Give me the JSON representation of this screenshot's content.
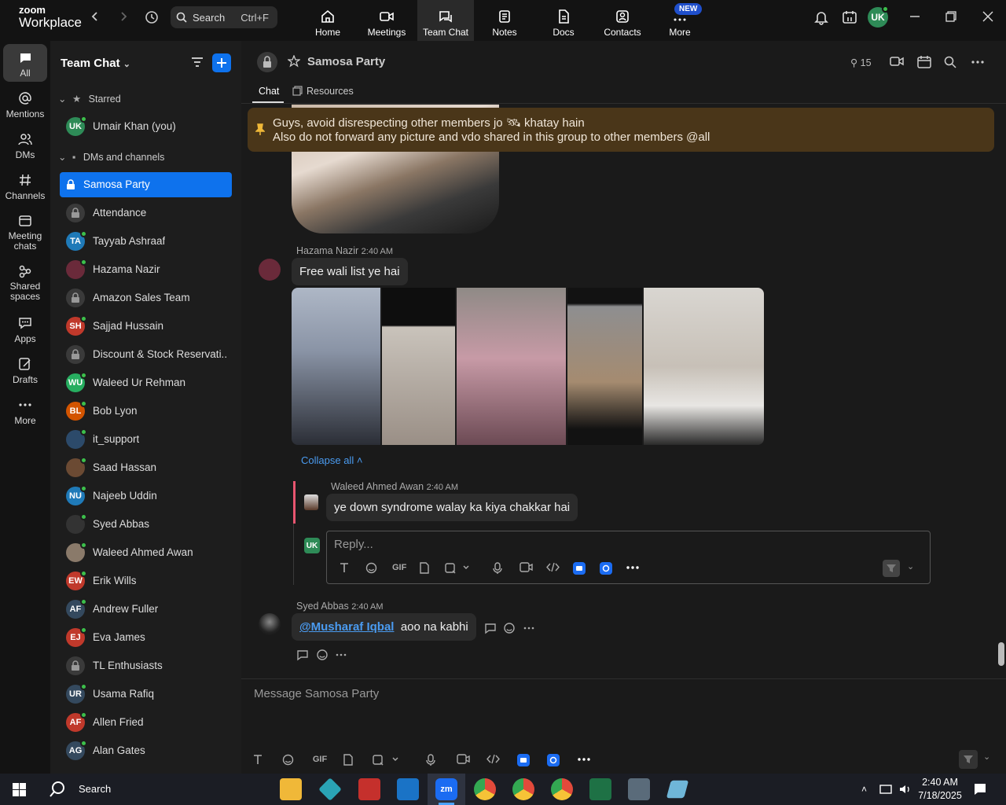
{
  "app": {
    "brand_top": "zoom",
    "brand_bottom": "Workplace"
  },
  "topbar": {
    "search_placeholder": "Search",
    "search_shortcut": "Ctrl+F",
    "nav": [
      {
        "label": "Home",
        "icon": "home-icon"
      },
      {
        "label": "Meetings",
        "icon": "video-icon"
      },
      {
        "label": "Team Chat",
        "icon": "chat-icon",
        "active": true
      },
      {
        "label": "Notes",
        "icon": "notes-icon"
      },
      {
        "label": "Docs",
        "icon": "docs-icon"
      },
      {
        "label": "Contacts",
        "icon": "contacts-icon"
      },
      {
        "label": "More",
        "icon": "more-icon"
      }
    ],
    "new_badge": "NEW",
    "user_initials": "UK"
  },
  "rail": [
    {
      "label": "All"
    },
    {
      "label": "Mentions"
    },
    {
      "label": "DMs"
    },
    {
      "label": "Channels"
    },
    {
      "label": "Meeting chats"
    },
    {
      "label": "Shared spaces"
    },
    {
      "label": "Apps"
    },
    {
      "label": "Drafts"
    },
    {
      "label": "More"
    }
  ],
  "sidebar": {
    "title": "Team Chat",
    "starred_label": "Starred",
    "dms_label": "DMs and channels",
    "starred": [
      {
        "name": "Umair Khan (you)",
        "initials": "UK",
        "color": "#2e8b57"
      }
    ],
    "items": [
      {
        "name": "Samosa Party",
        "type": "channel",
        "active": true
      },
      {
        "name": "Attendance",
        "type": "channel"
      },
      {
        "name": "Tayyab Ashraaf",
        "initials": "TA",
        "color": "#1f7ab8"
      },
      {
        "name": "Hazama Nazir",
        "initials": "",
        "color": "#6a2a3a"
      },
      {
        "name": "Amazon Sales Team",
        "type": "channel"
      },
      {
        "name": "Sajjad Hussain",
        "initials": "SH",
        "color": "#c0392b"
      },
      {
        "name": "Discount & Stock Reservati...",
        "type": "channel"
      },
      {
        "name": "Waleed Ur Rehman",
        "initials": "WU",
        "color": "#27ae60"
      },
      {
        "name": "Bob Lyon",
        "initials": "BL",
        "color": "#d35400"
      },
      {
        "name": "it_support",
        "initials": "",
        "color": "#2c4a6a"
      },
      {
        "name": "Saad Hassan",
        "initials": "",
        "color": "#6b4a33"
      },
      {
        "name": "Najeeb Uddin",
        "initials": "NU",
        "color": "#1f7ab8"
      },
      {
        "name": "Syed Abbas",
        "initials": "",
        "color": "#333333"
      },
      {
        "name": "Waleed Ahmed Awan",
        "initials": "",
        "color": "#8a7a6a"
      },
      {
        "name": "Erik Wills",
        "initials": "EW",
        "color": "#c0392b"
      },
      {
        "name": "Andrew Fuller",
        "initials": "AF",
        "color": "#34495e"
      },
      {
        "name": "Eva James",
        "initials": "EJ",
        "color": "#c0392b"
      },
      {
        "name": "TL Enthusiasts",
        "type": "channel"
      },
      {
        "name": "Usama Rafiq",
        "initials": "UR",
        "color": "#34495e"
      },
      {
        "name": "Allen Fried",
        "initials": "AF",
        "color": "#c0392b"
      },
      {
        "name": "Alan Gates",
        "initials": "AG",
        "color": "#34495e"
      }
    ]
  },
  "chat": {
    "title": "Samosa Party",
    "member_count": "15",
    "tabs": [
      "Chat",
      "Resources"
    ],
    "pinned": [
      "Guys, avoid disrespecting other members jo 🛰 khatay hain",
      "Also do not forward any picture and vdo shared in this group to other members @all"
    ],
    "messages": [
      {
        "sender": "Hazama Nazir",
        "time": "2:40 AM",
        "text": "Free wali list ye hai"
      },
      {
        "sender": "Waleed Ahmed Awan",
        "time": "2:40 AM",
        "text": "ye down syndrome walay ka kiya chakkar hai"
      },
      {
        "sender": "Syed Abbas",
        "time": "2:40 AM",
        "mention": "@Musharaf Iqbal",
        "text": "aoo na kabhi"
      }
    ],
    "collapse_label": "Collapse all",
    "reply_placeholder": "Reply...",
    "reply_avatar": "UK",
    "composer_placeholder": "Message Samosa Party",
    "toolbar_gif": "GIF"
  },
  "taskbar": {
    "search": "Search",
    "time": "2:40 AM",
    "date": "7/18/2025"
  }
}
